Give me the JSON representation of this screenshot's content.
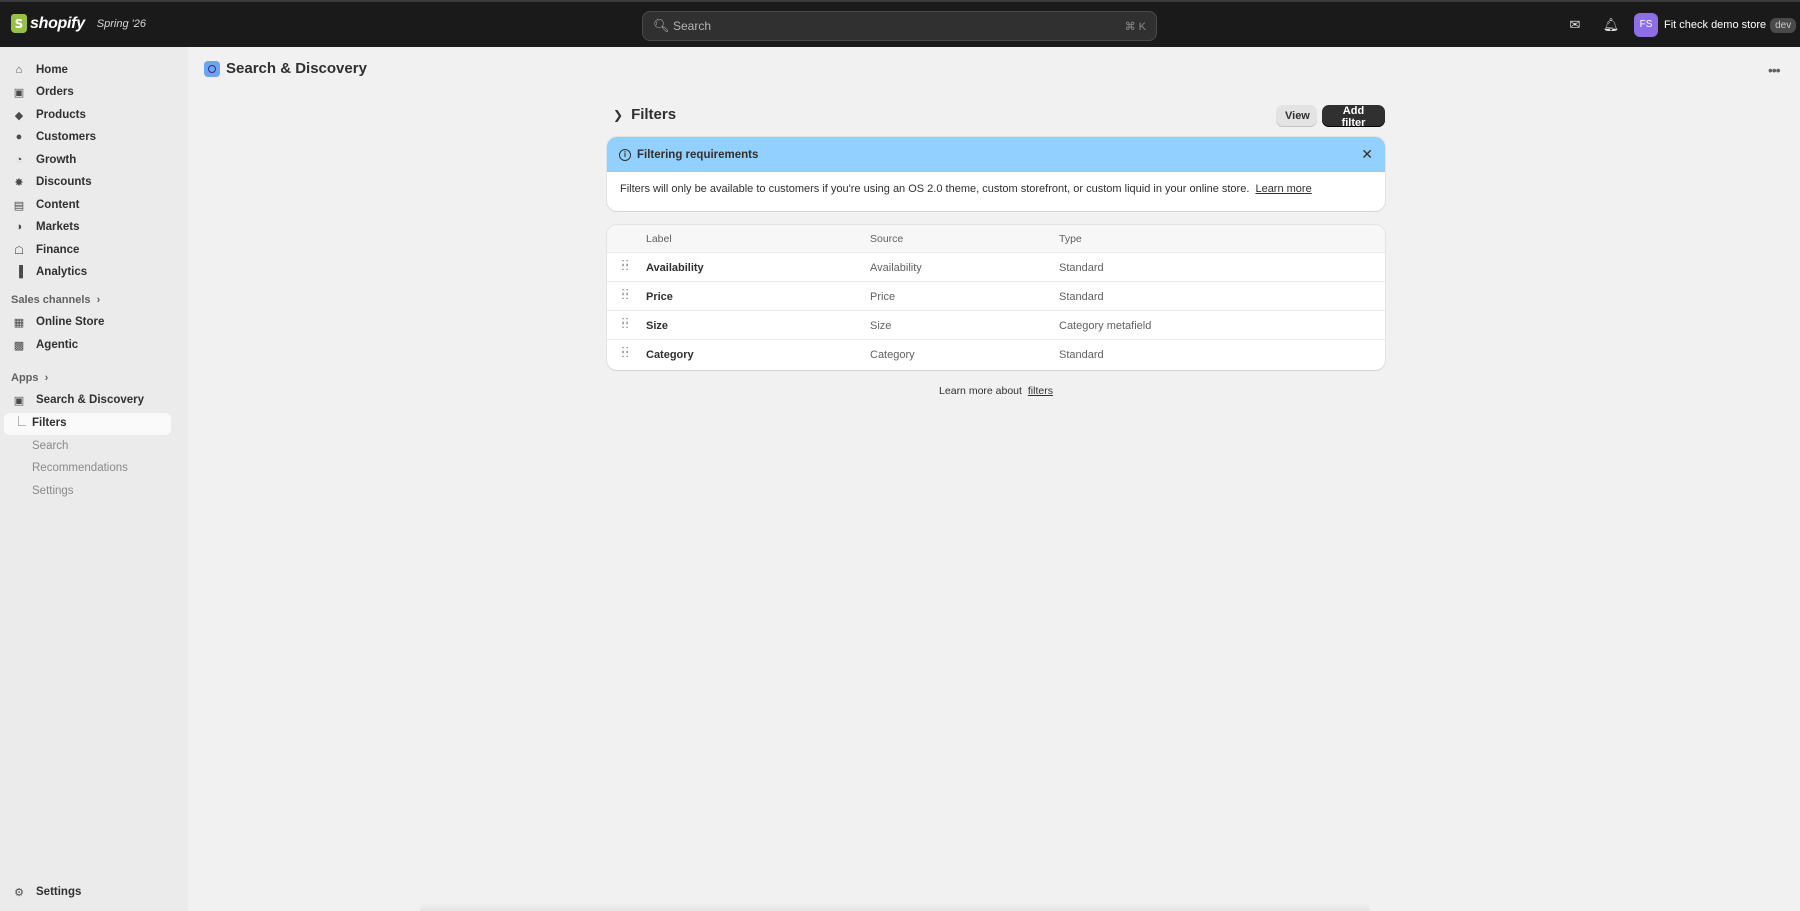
{
  "topbar": {
    "brand_mark": "S",
    "brand_name": "shopify",
    "edition": "Spring '26",
    "search_placeholder": "Search",
    "search_shortcut": "⌘  K",
    "store_initials": "FS",
    "store_name": "Fit check demo store",
    "store_badge": "dev",
    "icons": [
      "search-icon",
      "inbox-icon",
      "bell-icon"
    ]
  },
  "sidebar": {
    "items": [
      {
        "label": "Home",
        "icon": "home-icon"
      },
      {
        "label": "Orders",
        "icon": "orders-icon"
      },
      {
        "label": "Products",
        "icon": "tag-icon"
      },
      {
        "label": "Customers",
        "icon": "person-icon"
      },
      {
        "label": "Growth",
        "icon": "gauge-icon"
      },
      {
        "label": "Discounts",
        "icon": "discount-icon"
      },
      {
        "label": "Content",
        "icon": "content-icon"
      },
      {
        "label": "Markets",
        "icon": "globe-icon"
      },
      {
        "label": "Finance",
        "icon": "bank-icon"
      },
      {
        "label": "Analytics",
        "icon": "chart-bar-icon"
      }
    ],
    "sales_channels_label": "Sales channels",
    "channels": [
      {
        "label": "Online Store",
        "icon": "storefront-icon"
      },
      {
        "label": "Agentic",
        "icon": "agentic-icon"
      }
    ],
    "apps_label": "Apps",
    "app": {
      "label": "Search & Discovery",
      "icon": "app-search-icon"
    },
    "app_subitems": [
      "Filters",
      "Search",
      "Recommendations",
      "Settings"
    ],
    "settings_label": "Settings"
  },
  "main": {
    "page_title": "Search & Discovery",
    "section_title": "Filters",
    "view_button": "View",
    "add_button": "Add filter",
    "banner": {
      "title": "Filtering requirements",
      "body": "Filters will only be available to customers if you're using an OS 2.0 theme, custom storefront, or custom liquid in your online store.",
      "link": "Learn more"
    },
    "table": {
      "headers": [
        "Label",
        "Source",
        "Type"
      ],
      "rows": [
        {
          "label": "Availability",
          "source": "Availability",
          "type": "Standard"
        },
        {
          "label": "Price",
          "source": "Price",
          "type": "Standard"
        },
        {
          "label": "Size",
          "source": "Size",
          "type": "Category metafield"
        },
        {
          "label": "Category",
          "source": "Category",
          "type": "Standard"
        }
      ]
    },
    "footer_text": "Learn more about",
    "footer_link": "filters"
  },
  "colors": {
    "topbar_bg": "#1a1a1a",
    "banner_bg": "#91d0ff",
    "primary_button": "#303030",
    "avatar_bg": "#8e6ee6"
  }
}
